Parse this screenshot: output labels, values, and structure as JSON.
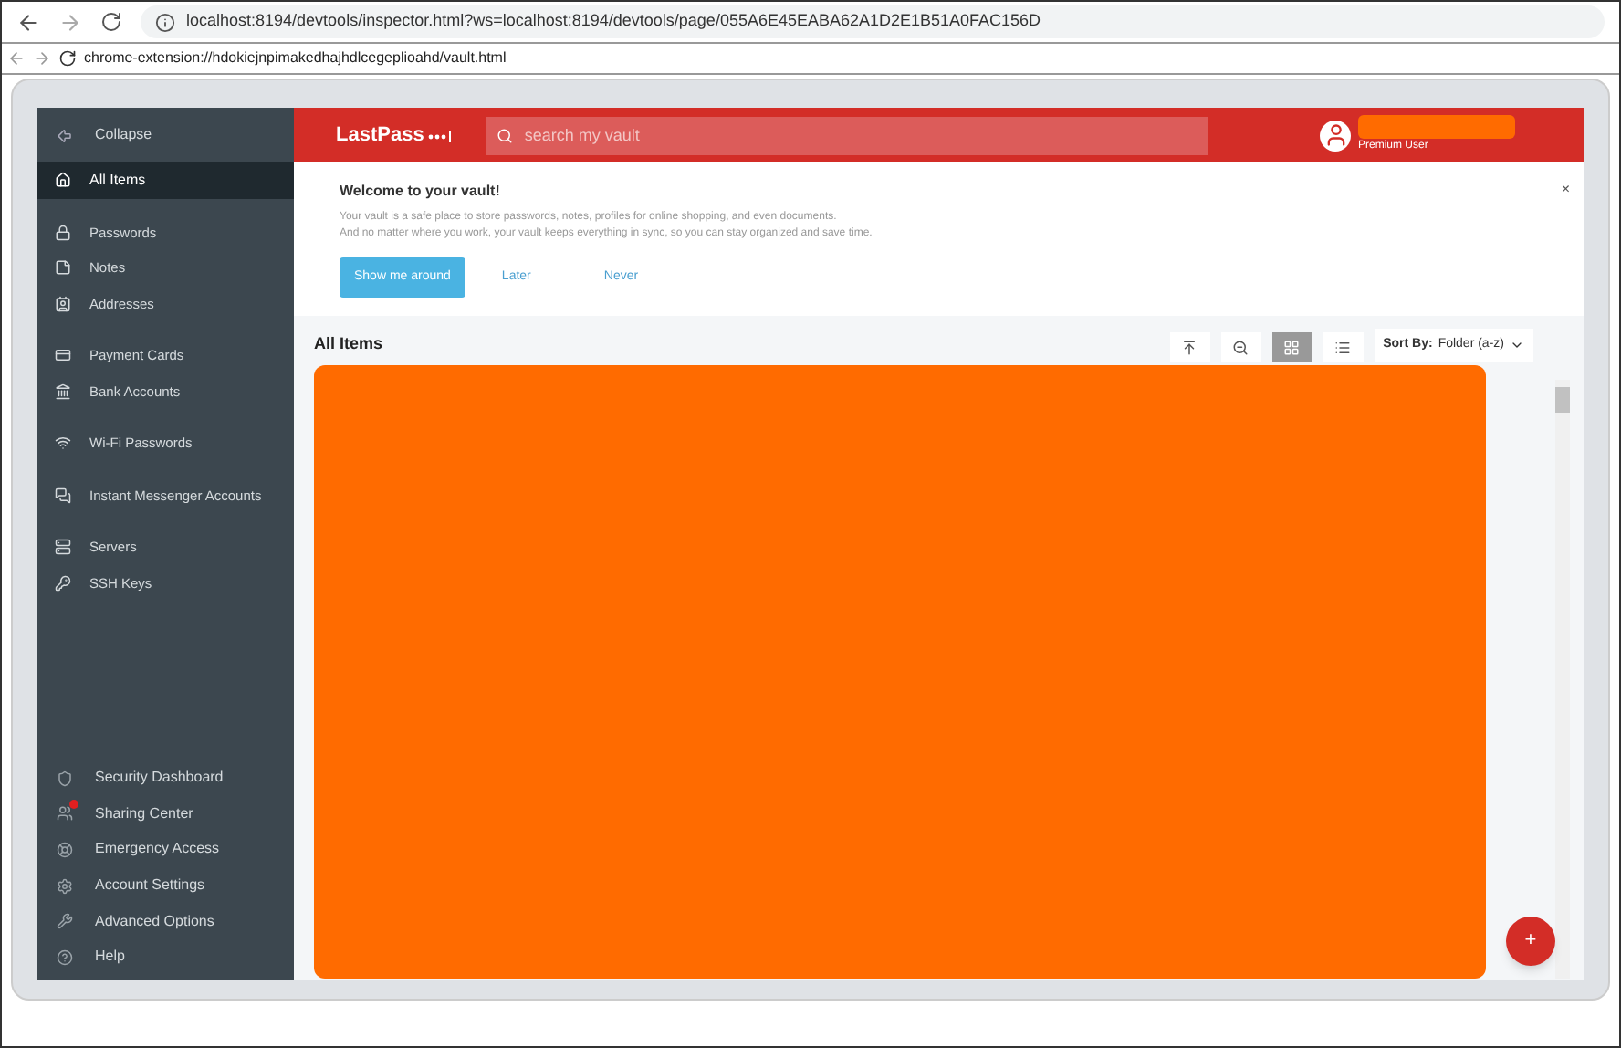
{
  "browser": {
    "url": "localhost:8194/devtools/inspector.html?ws=localhost:8194/devtools/page/055A6E45EABA62A1D2E1B51A0FAC156D",
    "inner_url": "chrome-extension://hdokiejnpimakedhajhdlcegeplioahd/vault.html"
  },
  "sidebar": {
    "collapse": "Collapse",
    "groups": [
      {
        "items": [
          {
            "label": "All Items",
            "selected": true
          }
        ]
      },
      {
        "items": [
          {
            "label": "Passwords",
            "selected": false
          },
          {
            "label": "Notes",
            "selected": false
          },
          {
            "label": "Addresses",
            "selected": false
          }
        ]
      },
      {
        "items": [
          {
            "label": "Payment Cards",
            "selected": false
          },
          {
            "label": "Bank Accounts",
            "selected": false
          }
        ]
      },
      {
        "items": [
          {
            "label": "Wi-Fi Passwords",
            "selected": false
          }
        ]
      },
      {
        "items": [
          {
            "label": "Instant Messenger Accounts",
            "selected": false
          }
        ]
      },
      {
        "items": [
          {
            "label": "Servers",
            "selected": false
          },
          {
            "label": "SSH Keys",
            "selected": false
          }
        ]
      }
    ],
    "bottom": [
      {
        "label": "Security Dashboard",
        "badge": false
      },
      {
        "label": "Sharing Center",
        "badge": true
      },
      {
        "label": "Emergency Access",
        "badge": false
      },
      {
        "label": "Account Settings",
        "badge": false
      },
      {
        "label": "Advanced Options",
        "badge": false
      },
      {
        "label": "Help",
        "badge": false
      }
    ]
  },
  "header": {
    "logo": "LastPass",
    "search": {
      "placeholder": "search my vault"
    },
    "user_status": "Premium User"
  },
  "welcome": {
    "title": "Welcome to your vault!",
    "lines": [
      "Your vault is a safe place to store passwords, notes, profiles for online shopping, and even documents.",
      "And no matter where you work, your vault keeps everything in sync, so you can stay organized and save time."
    ],
    "buttons": [
      "Show me around",
      "Later",
      "Never"
    ],
    "close": "×"
  },
  "content": {
    "title": "All Items",
    "views": [
      {
        "kind": "grid",
        "selected": true
      },
      {
        "kind": "list",
        "selected": false
      }
    ],
    "sort_label": "Sort By:",
    "sort_value": "Folder (a-z)",
    "add_button": "+"
  }
}
